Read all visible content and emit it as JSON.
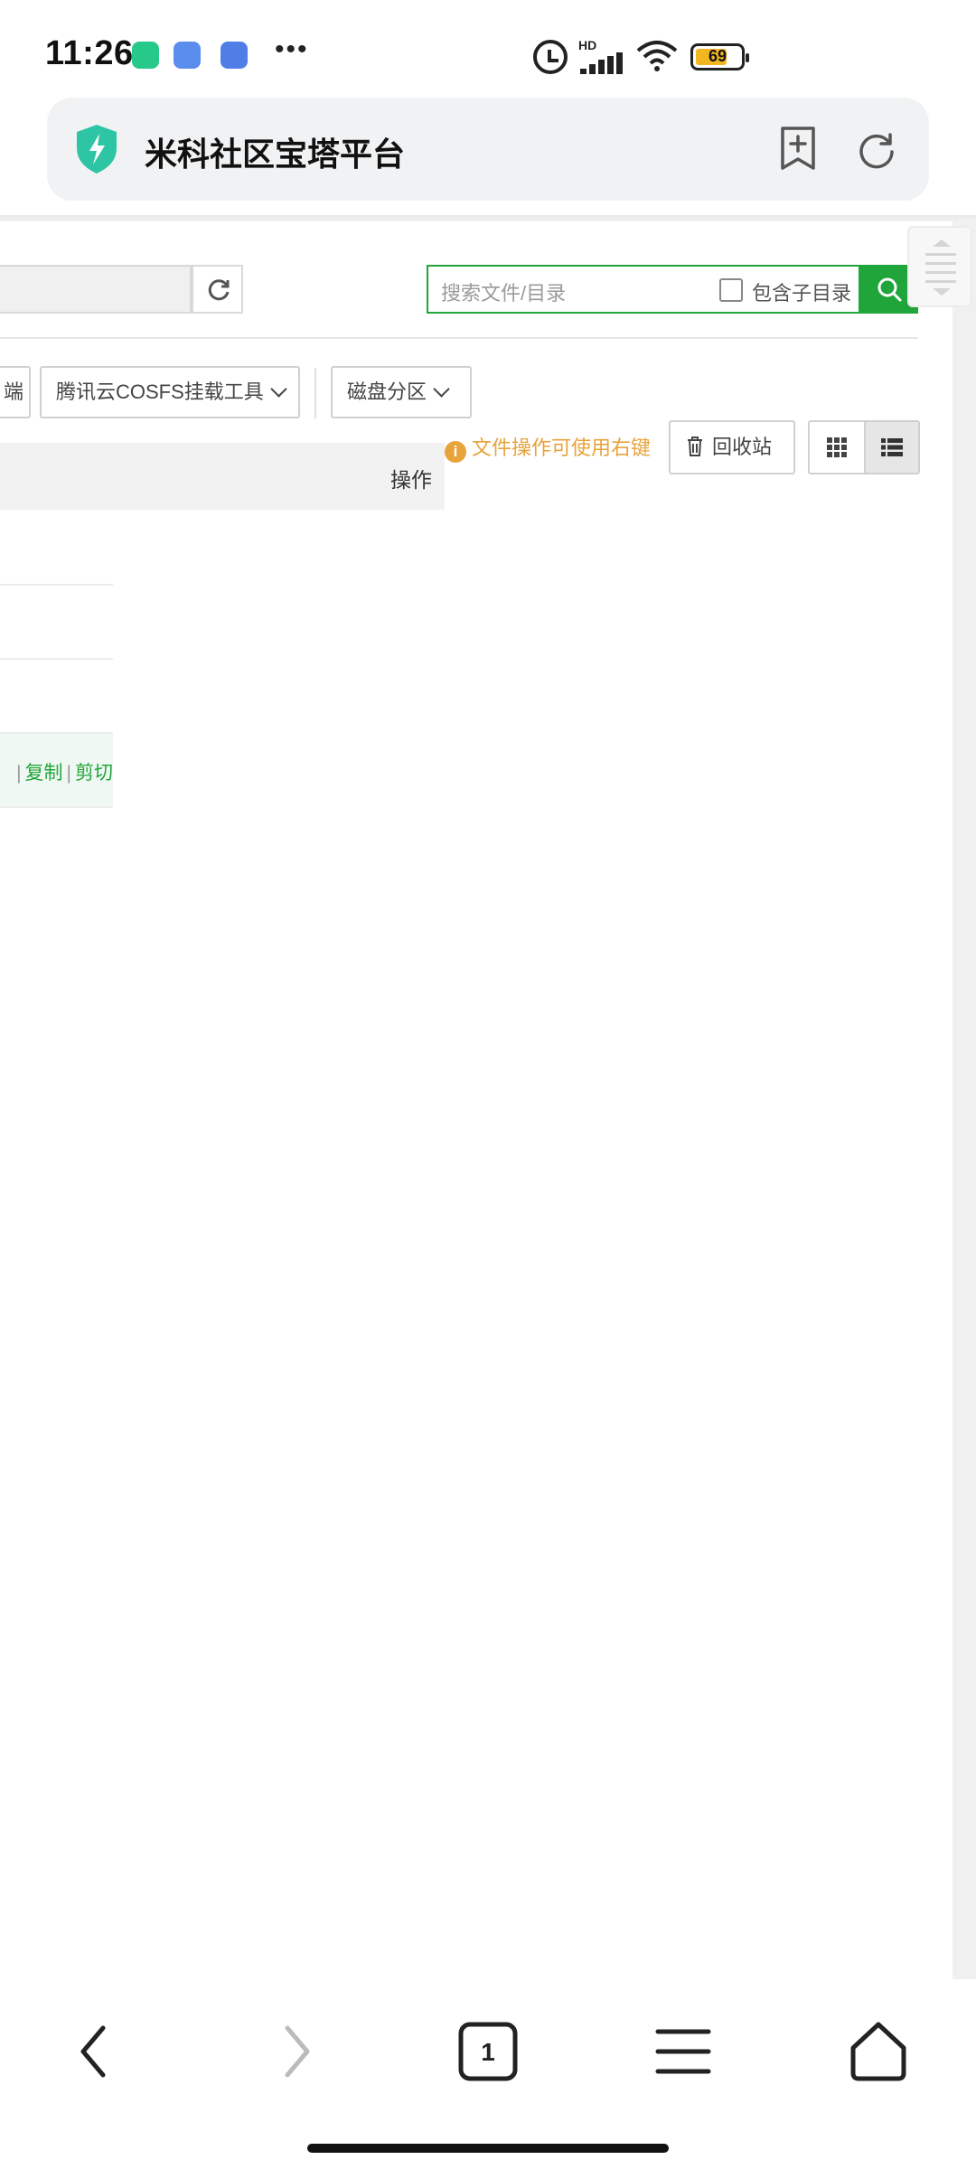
{
  "status_bar": {
    "time": "11:26",
    "network_label": "HD",
    "battery": "69"
  },
  "address_bar": {
    "title": "米科社区宝塔平台"
  },
  "toolbar": {
    "search_placeholder": "搜索文件/目录",
    "include_subdir_label": "包含子目录",
    "truncated_button_label": "端",
    "cosfs_button_label": "腾讯云COSFS挂载工具",
    "disk_button_label": "磁盘分区",
    "hint_text": "文件操作可使用右键",
    "recycle_button_label": "回收站"
  },
  "table": {
    "column_action": "操作",
    "row_actions": [
      "复制",
      "剪切"
    ]
  },
  "colors": {
    "accent": "#20a53a",
    "hint": "#e8a33b"
  }
}
